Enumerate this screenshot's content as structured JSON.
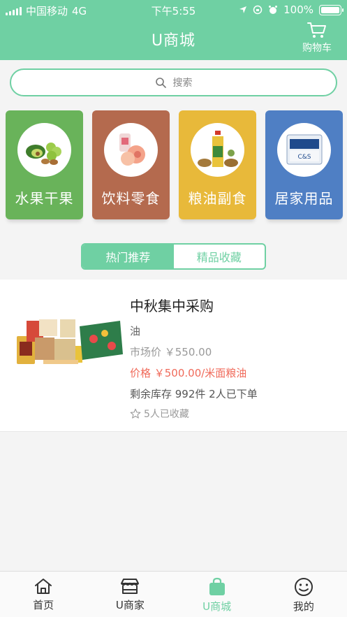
{
  "status": {
    "carrier": "中国移动",
    "network": "4G",
    "time": "下午5:55",
    "battery": "100%"
  },
  "header": {
    "title": "U商城",
    "cart_label": "购物车"
  },
  "search": {
    "placeholder": "搜索"
  },
  "categories": [
    {
      "label": "水果干果",
      "color": "#69b35a",
      "icon": "fruit-icon"
    },
    {
      "label": "饮料零食",
      "color": "#b46a4e",
      "icon": "snack-icon"
    },
    {
      "label": "粮油副食",
      "color": "#e8b93a",
      "icon": "oil-icon"
    },
    {
      "label": "居家用品",
      "color": "#4f7fc4",
      "icon": "household-icon"
    }
  ],
  "tabs": {
    "hot": "热门推荐",
    "collection": "精品收藏"
  },
  "product": {
    "name": "中秋集中采购",
    "category": "油",
    "market_price": "市场价 ￥550.00",
    "price": "价格 ￥500.00/米面粮油",
    "stock": "剩余库存 992件 2人已下单",
    "favorites": "5人已收藏"
  },
  "nav": {
    "home": "首页",
    "merchant": "U商家",
    "mall": "U商城",
    "mine": "我的"
  },
  "colors": {
    "primary": "#6fd0a3",
    "price": "#f06a5a"
  }
}
